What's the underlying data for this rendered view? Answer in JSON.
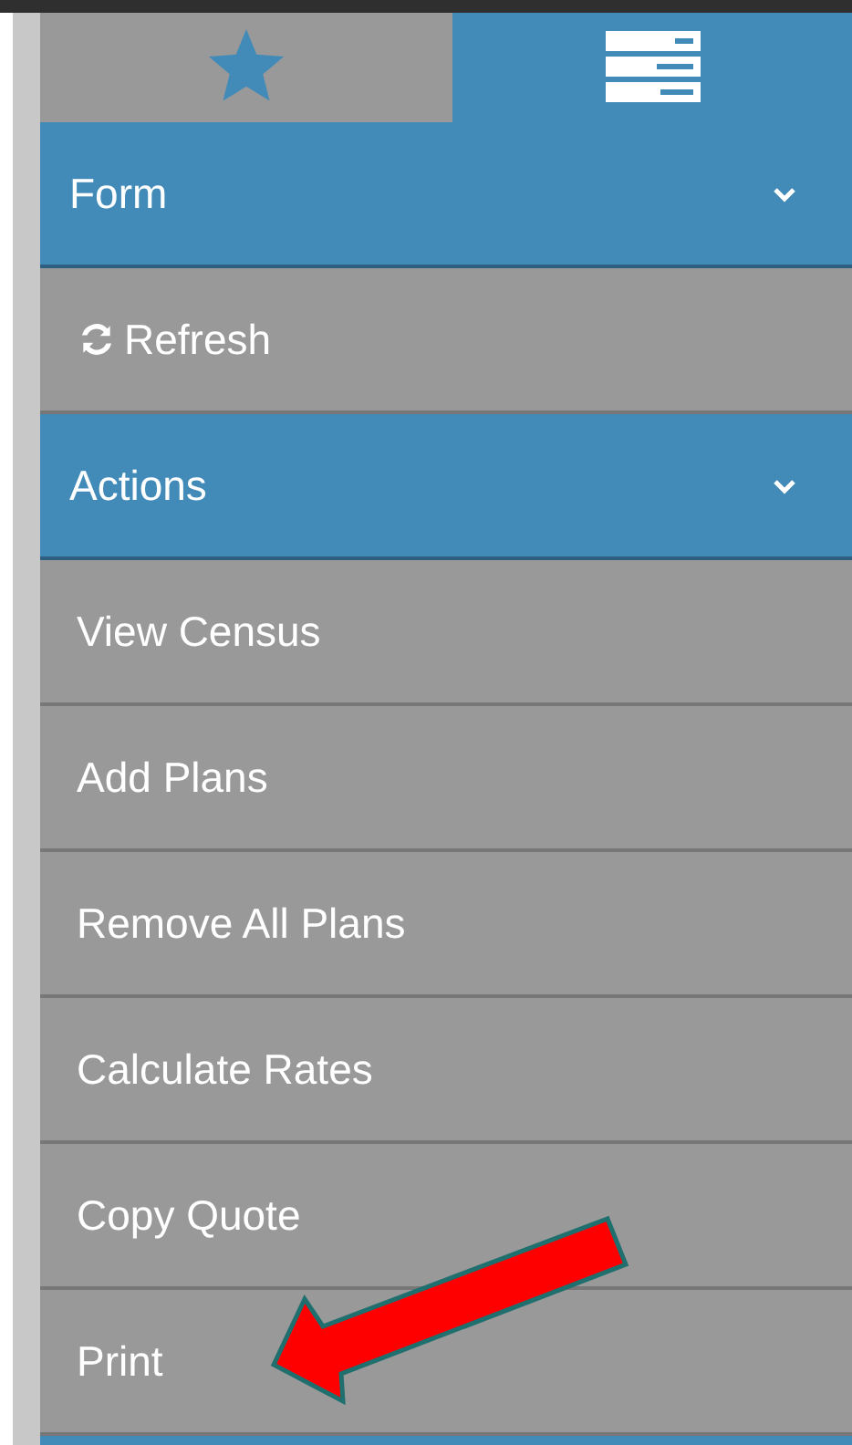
{
  "tabs": [
    {
      "kind": "favorites",
      "selected": false
    },
    {
      "kind": "list",
      "selected": true
    }
  ],
  "menu": [
    {
      "kind": "section",
      "label": "Form",
      "expanded": true
    },
    {
      "kind": "icon-item",
      "label": "Refresh"
    },
    {
      "kind": "section",
      "label": "Actions",
      "expanded": true
    },
    {
      "kind": "item",
      "label": "View Census"
    },
    {
      "kind": "item",
      "label": "Add Plans"
    },
    {
      "kind": "item",
      "label": "Remove All Plans"
    },
    {
      "kind": "item",
      "label": "Calculate Rates"
    },
    {
      "kind": "item",
      "label": "Copy Quote"
    },
    {
      "kind": "item",
      "label": "Print"
    }
  ]
}
